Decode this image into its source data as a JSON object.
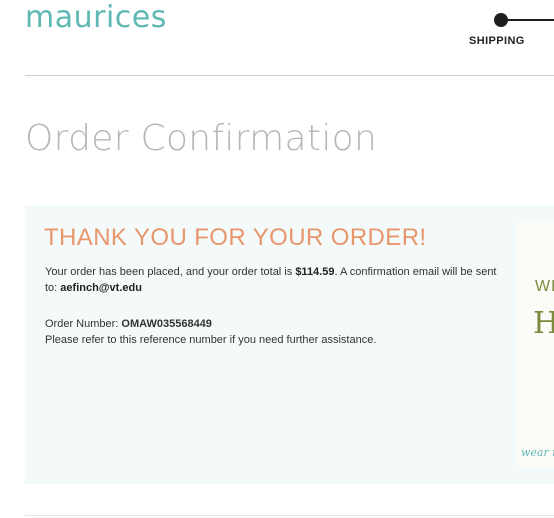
{
  "header": {
    "logo_text": "maurices",
    "progress": {
      "current_step_label": "SHIPPING"
    }
  },
  "main": {
    "page_title": "Order Confirmation",
    "confirmation": {
      "heading": "THANK YOU FOR YOUR ORDER!",
      "message_part1": "Your order has been placed, and your order total is ",
      "order_total": "$114.59",
      "message_part2": ". A confirmation email will be sent to: ",
      "email": "aefinch@vt.edu",
      "order_number_label": "Order Number: ",
      "order_number": "OMAW035568449",
      "reference_note": "Please refer to this reference number if you need further assistance."
    },
    "promo": {
      "line1": "WE",
      "line2": "HO",
      "tagline": "wear i"
    }
  },
  "colors": {
    "brand_teal": "#5fb8b2",
    "heading_orange": "#e8966c",
    "title_gray": "#b6b6b6",
    "box_bg": "#f4fafa"
  }
}
